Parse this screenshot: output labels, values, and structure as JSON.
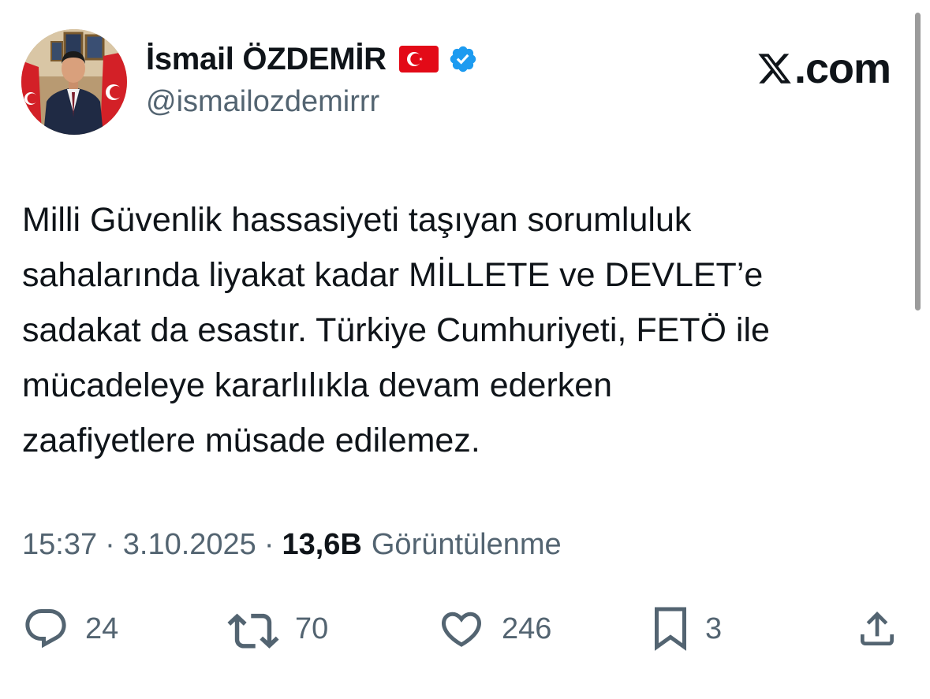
{
  "author": {
    "display_name": "İsmail ÖZDEMİR",
    "handle": "@ismailozdemirrr",
    "flag_icon": "turkey-flag-icon",
    "verified_icon": "verified-badge-icon",
    "verified_color": "#1d9bf0"
  },
  "brand": {
    "label": ".com",
    "icon": "x-logo-icon"
  },
  "tweet": {
    "lines": [
      "Milli Güvenlik hassasiyeti taşıyan sorumluluk",
      "sahalarında liyakat kadar MİLLETE ve DEVLET’e",
      "sadakat da esastır. Türkiye Cumhuriyeti, FETÖ ile",
      "mücadeleye kararlılıkla devam ederken",
      "zaafiyetlere müsade edilemez."
    ]
  },
  "meta": {
    "time": "15:37",
    "separator": "·",
    "date": "3.10.2025",
    "views_count": "13,6B",
    "views_label": "Görüntülenme"
  },
  "actions": {
    "reply": {
      "icon": "reply-icon",
      "count": "24"
    },
    "retweet": {
      "icon": "retweet-icon",
      "count": "70"
    },
    "like": {
      "icon": "heart-icon",
      "count": "246"
    },
    "bookmark": {
      "icon": "bookmark-icon",
      "count": "3"
    },
    "share": {
      "icon": "share-icon"
    }
  },
  "colors": {
    "text_primary": "#0f1419",
    "text_secondary": "#536471",
    "flag_red": "#e30a17"
  }
}
